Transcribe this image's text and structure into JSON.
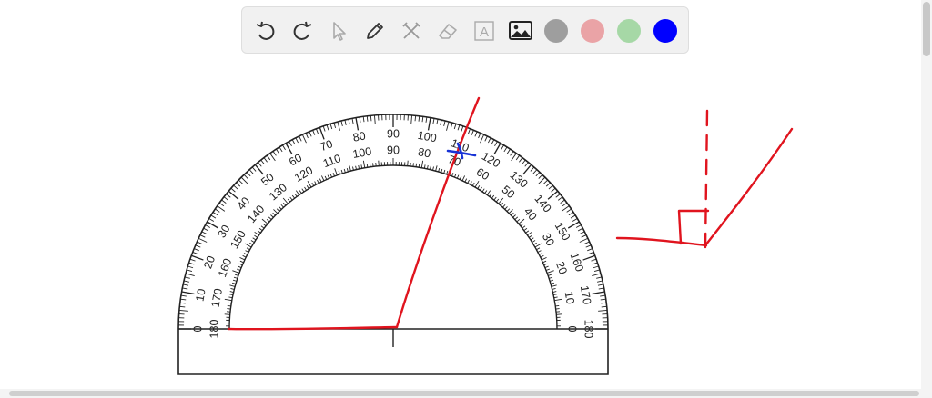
{
  "toolbar": {
    "tools": [
      {
        "icon": "undo-icon"
      },
      {
        "icon": "redo-icon"
      },
      {
        "icon": "pointer-icon"
      },
      {
        "icon": "pen-icon"
      },
      {
        "icon": "tools-icon"
      },
      {
        "icon": "eraser-icon"
      },
      {
        "icon": "text-icon",
        "glyph": "A"
      },
      {
        "icon": "image-icon"
      }
    ],
    "colors": [
      "#9e9e9e",
      "#eaa3a6",
      "#a6d8a6",
      "#0000ff"
    ],
    "selected_color": "#0000ff"
  },
  "protractor": {
    "outer_scale": [
      "0",
      "10",
      "20",
      "30",
      "40",
      "50",
      "60",
      "70",
      "80",
      "90",
      "100",
      "110",
      "120",
      "130",
      "140",
      "150",
      "160",
      "170",
      "180"
    ],
    "inner_scale": [
      "180",
      "170",
      "160",
      "150",
      "140",
      "130",
      "120",
      "110",
      "100",
      "90",
      "80",
      "70",
      "60",
      "50",
      "40",
      "30",
      "20",
      "10",
      "0"
    ]
  },
  "ink_colors": {
    "red": "#e0141e",
    "blue": "#1833d6"
  }
}
